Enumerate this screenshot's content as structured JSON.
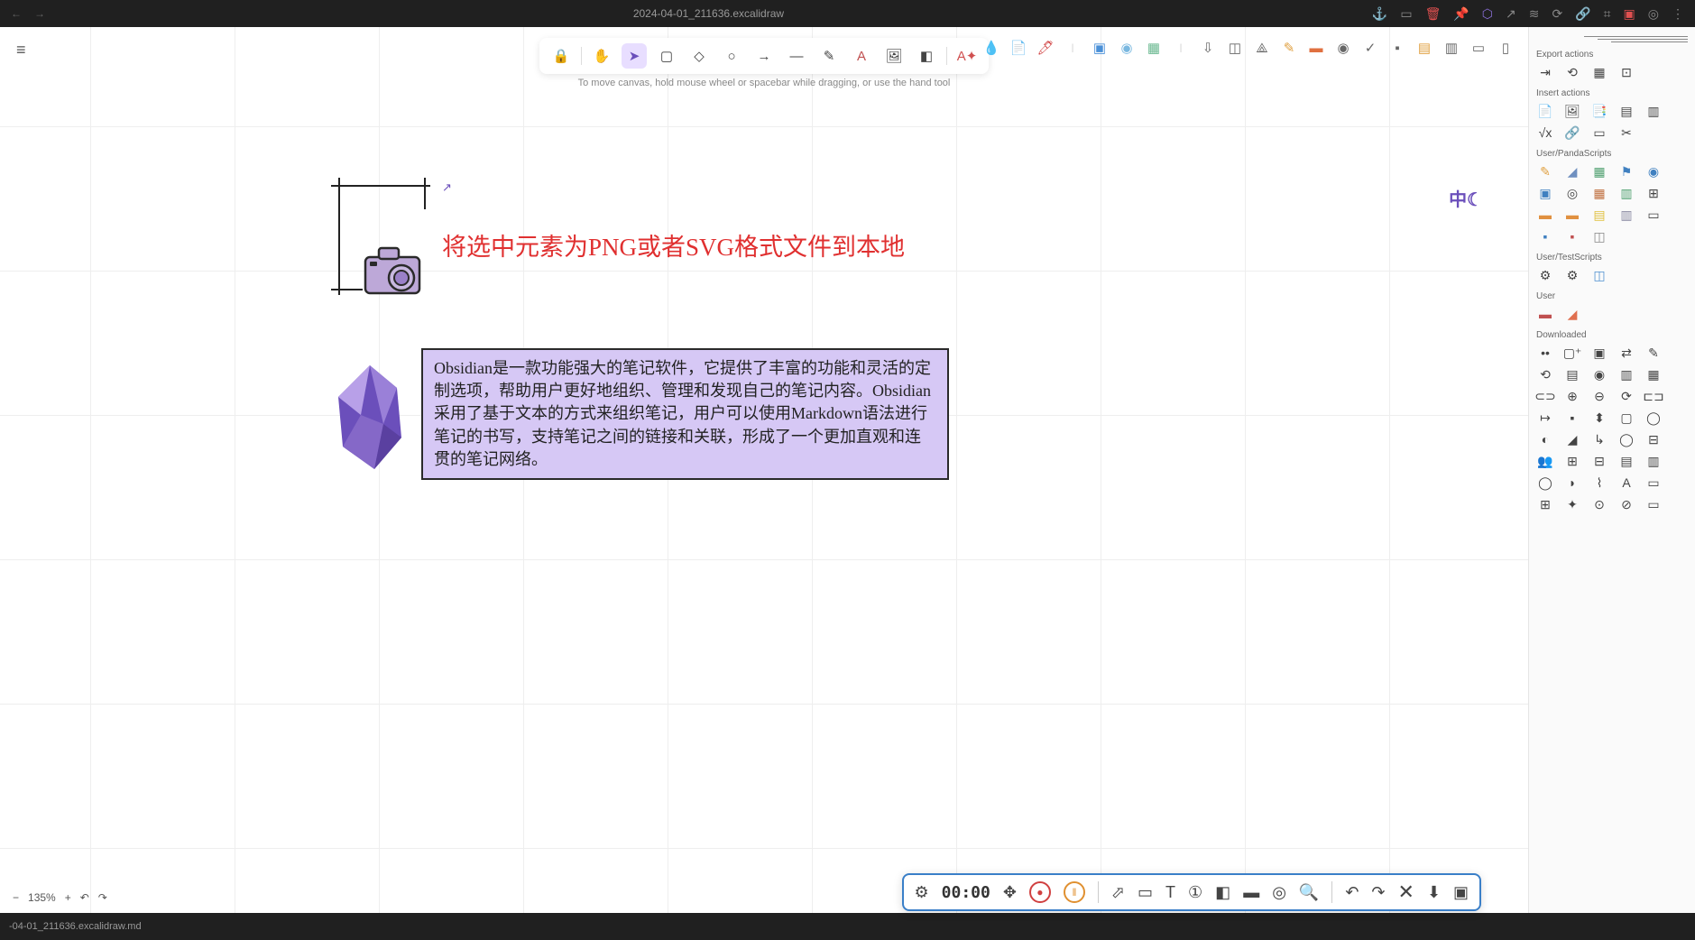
{
  "titlebar": {
    "title": "2024-04-01_211636.excalidraw"
  },
  "hint": "To move canvas, hold mouse wheel or spacebar while dragging, or use the hand tool",
  "canvas": {
    "red_text": "将选中元素为PNG或者SVG格式文件到本地",
    "zhong": "中☾",
    "box_text": "Obsidian是一款功能强大的笔记软件，它提供了丰富的功能和灵活的定制选项，帮助用户更好地组织、管理和发现自己的笔记内容。Obsidian采用了基于文本的方式来组织笔记，用户可以使用Markdown语法进行笔记的书写，支持笔记之间的链接和关联，形成了一个更加直观和连贯的笔记网络。"
  },
  "right_panel": {
    "s1": "Export actions",
    "s2": "Insert actions",
    "s3": "User/PandaScripts",
    "s4": "User/TestScripts",
    "s5": "User",
    "s6": "Downloaded"
  },
  "zoom": "135%",
  "status": "-04-01_211636.excalidraw.md",
  "rec": {
    "timer": "00:00"
  }
}
